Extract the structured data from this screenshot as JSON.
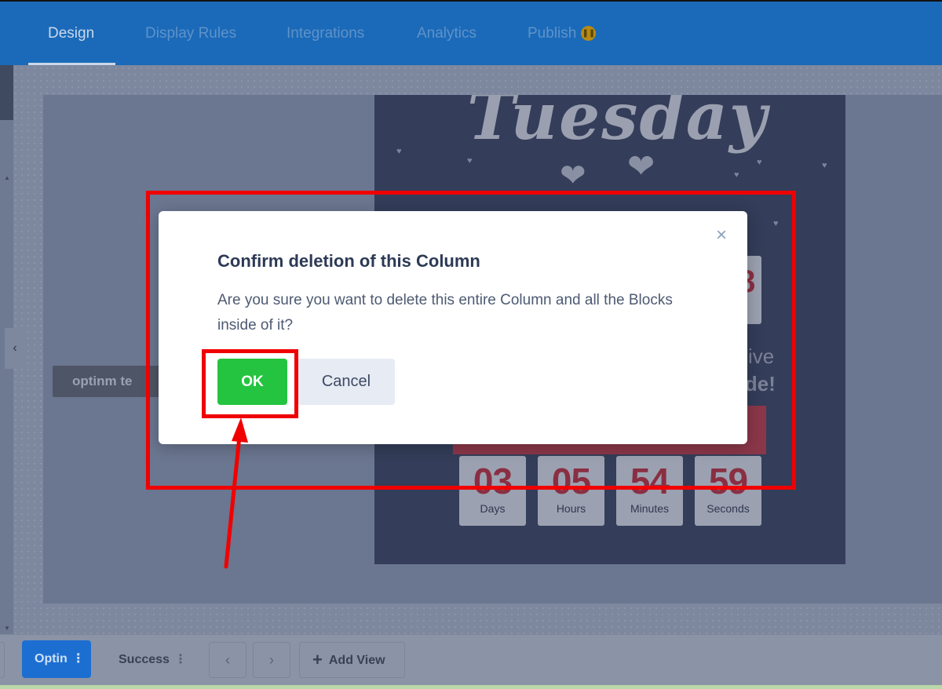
{
  "nav": {
    "tabs": [
      {
        "label": "Design"
      },
      {
        "label": "Display Rules"
      },
      {
        "label": "Integrations"
      },
      {
        "label": "Analytics"
      },
      {
        "label": "Publish"
      }
    ],
    "publish_badge_icon": "pause-icon"
  },
  "canvas": {
    "logo_text": "optinm  te",
    "preview": {
      "headline": "Tuesday",
      "partial_text_1": "ive",
      "partial_text_2": "ode!",
      "partial_number": "8",
      "countdown": [
        {
          "value": "03",
          "label": "Days"
        },
        {
          "value": "05",
          "label": "Hours"
        },
        {
          "value": "54",
          "label": "Minutes"
        },
        {
          "value": "59",
          "label": "Seconds"
        }
      ]
    }
  },
  "modal": {
    "title": "Confirm deletion of this Column",
    "message": "Are you sure you want to delete this entire Column and all the Blocks inside of it?",
    "ok_label": "OK",
    "cancel_label": "Cancel",
    "close_icon": "×"
  },
  "bottom": {
    "optin_label": "Optin",
    "success_label": "Success",
    "add_view_label": "Add View",
    "prev_icon": "‹",
    "next_icon": "›"
  },
  "colors": {
    "nav_bg": "#1b6ab9",
    "ok_green": "#24c440",
    "annotation_red": "#f00000"
  }
}
